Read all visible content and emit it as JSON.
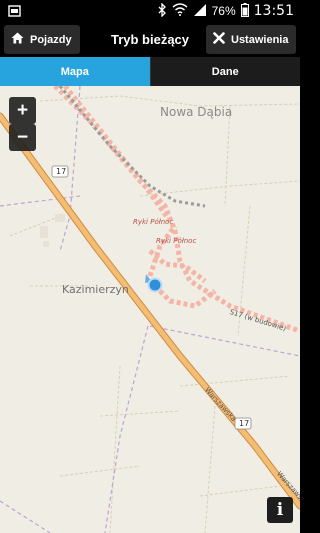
{
  "status_bar": {
    "battery": "76%",
    "clock": "13:51",
    "icons": [
      "notification-icon",
      "bluetooth-icon",
      "wifi-icon",
      "signal-icon",
      "battery-icon"
    ]
  },
  "topbar": {
    "back_label": "Pojazdy",
    "title": "Tryb bieżący",
    "settings_label": "Ustawienia"
  },
  "tabs": [
    {
      "label": "Mapa",
      "active": true
    },
    {
      "label": "Dane",
      "active": false
    }
  ],
  "map": {
    "zoom_in": "+",
    "zoom_out": "−",
    "info": "i",
    "labels": {
      "nowa_dabia": "Nowa Dąbia",
      "ryki_polnoc_1": "Ryki Północ",
      "ryki_polnoc_2": "Ryki Północ",
      "kazimierzyn": "Kazimierzyn",
      "s17": "S17 (w budowie)",
      "warszawska_1": "Warszawska",
      "warszawska_2": "Warszawska",
      "road_17_top": "17",
      "road_17_bottom": "17"
    },
    "colors": {
      "background": "#f0ede4",
      "main_road": "#e6a65c",
      "construction": "#f4b0a4",
      "accent_tab": "#27a3dd",
      "position_dot": "#2f8fd9"
    }
  }
}
